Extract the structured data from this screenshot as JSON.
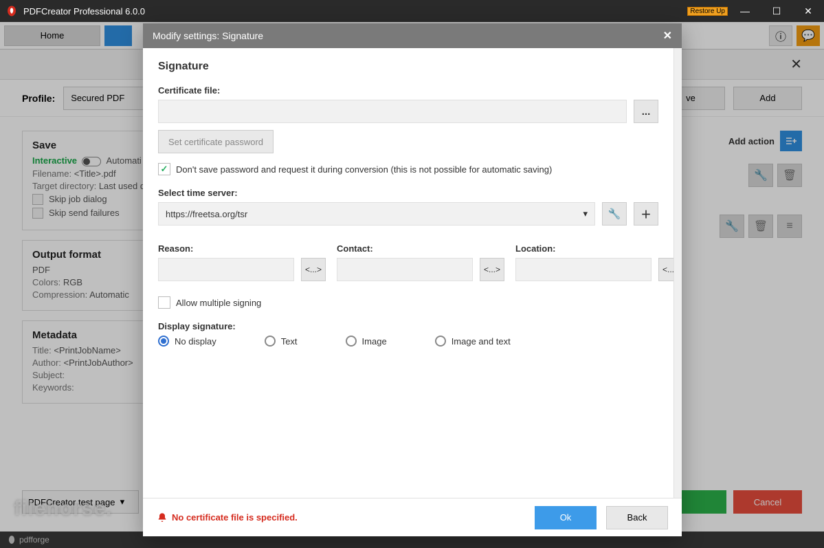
{
  "window": {
    "title": "PDFCreator Professional 6.0.0",
    "tag": "Restore Up"
  },
  "nav": {
    "home": "Home"
  },
  "topright": {
    "info_glyph": "ⓘ",
    "chat_glyph": "💬"
  },
  "profile": {
    "label": "Profile:",
    "selected": "Secured PDF",
    "ve_btn": "ve",
    "add_btn": "Add"
  },
  "add_action": "Add action",
  "save_card": {
    "title": "Save",
    "interactive": "Interactive",
    "automatic": "Automati",
    "filename_k": "Filename:",
    "filename_v": "<Title>.pdf",
    "target_k": "Target directory:",
    "target_v": "Last used d",
    "skip_job": "Skip job dialog",
    "skip_send": "Skip send failures"
  },
  "output_card": {
    "title": "Output format",
    "fmt": "PDF",
    "colors_k": "Colors:",
    "colors_v": "RGB",
    "comp_k": "Compression:",
    "comp_v": "Automatic"
  },
  "meta_card": {
    "title": "Metadata",
    "title_k": "Title:",
    "title_v": "<PrintJobName>",
    "author_k": "Author:",
    "author_v": "<PrintJobAuthor>",
    "subject_k": "Subject:",
    "keywords_k": "Keywords:"
  },
  "bottom": {
    "test_page": "PDFCreator test page",
    "cancel": "Cancel"
  },
  "footer": "pdfforge",
  "watermark": "filehorse.",
  "modal": {
    "title": "Modify settings: Signature",
    "heading": "Signature",
    "cert_label": "Certificate file:",
    "browse": "...",
    "set_pwd": "Set certificate password",
    "dont_save": "Don't save password and request it during conversion (this is not possible for automatic saving)",
    "time_label": "Select time server:",
    "time_value": "https://freetsa.org/tsr",
    "reason_label": "Reason:",
    "contact_label": "Contact:",
    "location_label": "Location:",
    "token": "<...>",
    "allow_multi": "Allow multiple signing",
    "display_label": "Display signature:",
    "r_none": "No display",
    "r_text": "Text",
    "r_image": "Image",
    "r_both": "Image and text",
    "error": "No certificate file is specified.",
    "ok": "Ok",
    "back": "Back"
  }
}
